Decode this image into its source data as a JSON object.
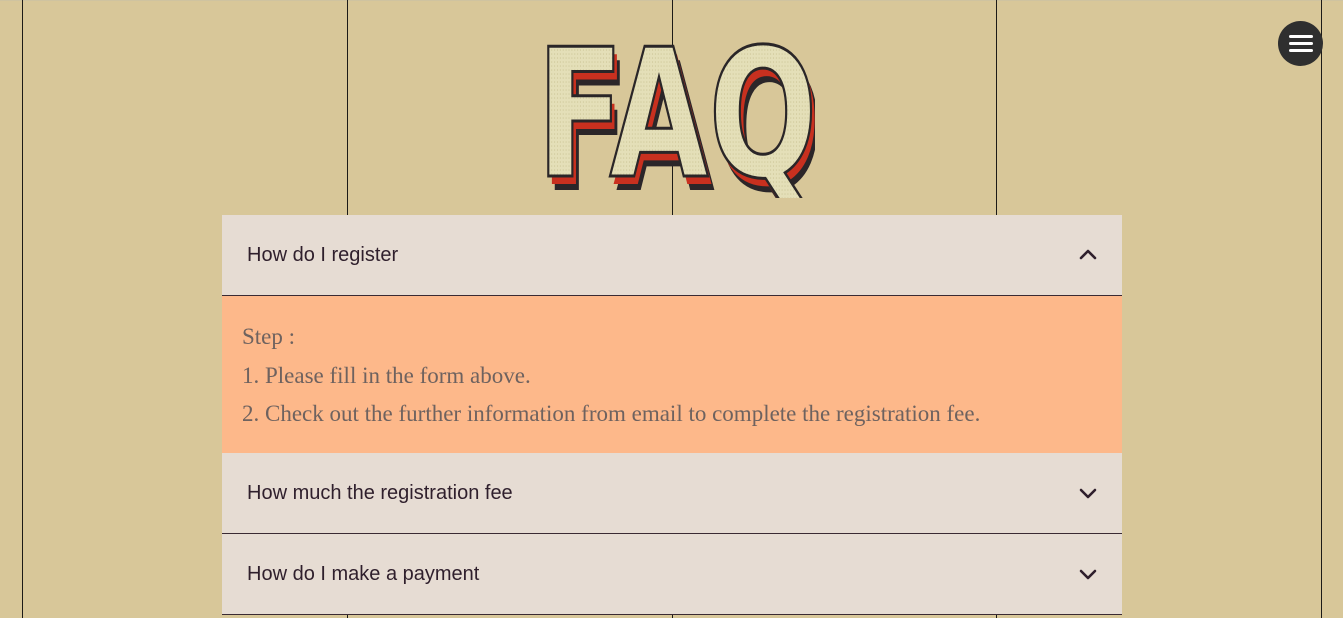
{
  "logo": {
    "text": "FAQ",
    "colors": {
      "face": "#e4dfb8",
      "outline": "#2a2628",
      "accent": "#c8301f",
      "shadow": "#2b2629"
    }
  },
  "menu": {
    "icon": "hamburger-menu-icon"
  },
  "faq": {
    "items": [
      {
        "question": "How do I register",
        "expanded": true,
        "icon": "chevron-up-icon",
        "answer_lines": [
          "Step :",
          "1. Please fill in the form above.",
          "2. Check out the further information from email to complete the registration fee."
        ]
      },
      {
        "question": "How much the registration fee",
        "expanded": false,
        "icon": "chevron-down-icon"
      },
      {
        "question": "How do I make a payment",
        "expanded": false,
        "icon": "chevron-down-icon"
      }
    ]
  },
  "colors": {
    "page_background": "#d8c799",
    "question_background": "#e6dcd3",
    "answer_background": "#fdb88a",
    "question_text": "#2f1f2c",
    "answer_text": "#6e625f",
    "menu_button": "#2f2f2f"
  }
}
